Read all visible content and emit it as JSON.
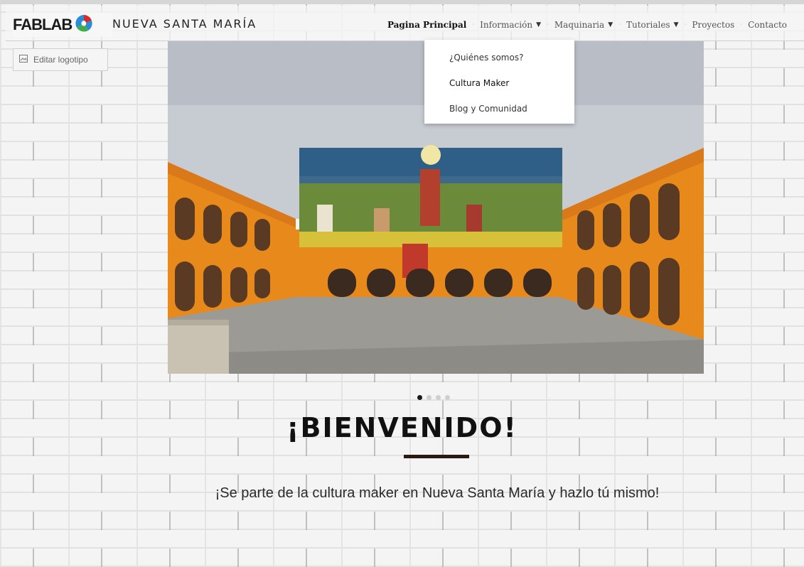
{
  "header": {
    "logo_text": "FABLAB",
    "site_name": "NUEVA SANTA MARÍA",
    "edit_logo_label": "Editar logotipo"
  },
  "nav": {
    "items": [
      {
        "label": "Pagina Principal",
        "active": true
      },
      {
        "label": "Información",
        "has_dropdown": true
      },
      {
        "label": "Maquinaria",
        "has_dropdown": true
      },
      {
        "label": "Tutoriales",
        "has_dropdown": true
      },
      {
        "label": "Proyectos"
      },
      {
        "label": "Contacto"
      }
    ]
  },
  "dropdown": {
    "items": [
      {
        "label": "¿Quiénes somos?"
      },
      {
        "label": "Cultura Maker"
      },
      {
        "label": "Blog y Comunidad"
      }
    ]
  },
  "slider": {
    "dot_count": 4,
    "active_index": 0
  },
  "hero": {
    "welcome": "¡BIENVENIDO!",
    "subtitle": "¡Se parte de la cultura maker en Nueva Santa María y hazlo tú mismo!"
  },
  "colors": {
    "orange": "#e8891c",
    "underline": "#2b1a12",
    "text_dark": "#111111"
  }
}
